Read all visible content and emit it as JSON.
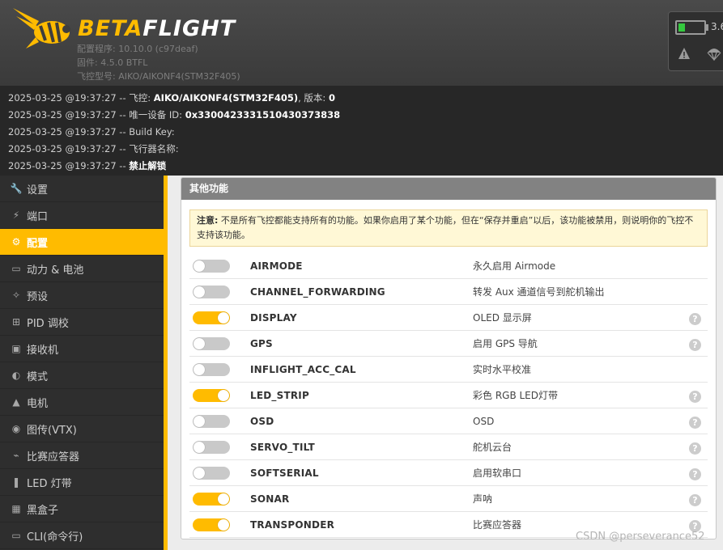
{
  "header": {
    "brand_a": "BETA",
    "brand_b": "FLIGHT",
    "config_version": "配置程序: 10.10.0 (c97deaf)",
    "firmware": "固件: 4.5.0 BTFL",
    "target": "飞控型号: AIKO/AIKONF4(STM32F405)",
    "battery_voltage": "3.6",
    "battery_level": 0.25,
    "accent_color": "#ffbb00"
  },
  "log": [
    {
      "prefix": "2025-03-25 @19:37:27 -- 飞控: ",
      "bold": "AIKO/AIKONF4(STM32F405)",
      "mid": ", 版本: ",
      "bold2": "0"
    },
    {
      "prefix": "2025-03-25 @19:37:27 -- 唯一设备 ID: ",
      "bold": "0x3300423331510430373838",
      "mid": "",
      "bold2": ""
    },
    {
      "prefix": "2025-03-25 @19:37:27 -- Build Key: ",
      "bold": "",
      "mid": "",
      "bold2": ""
    },
    {
      "prefix": "2025-03-25 @19:37:27 -- 飞行器名称: ",
      "bold": "",
      "mid": "",
      "bold2": ""
    },
    {
      "prefix": "2025-03-25 @19:37:27 -- ",
      "bold": "禁止解锁",
      "mid": "",
      "bold2": ""
    }
  ],
  "sidebar": {
    "items": [
      {
        "label": "设置",
        "icon": "wrench-icon"
      },
      {
        "label": "端口",
        "icon": "plug-icon"
      },
      {
        "label": "配置",
        "icon": "gear-icon"
      },
      {
        "label": "动力 & 电池",
        "icon": "battery-icon"
      },
      {
        "label": "预设",
        "icon": "magic-icon"
      },
      {
        "label": "PID 调校",
        "icon": "sitemap-icon"
      },
      {
        "label": "接收机",
        "icon": "receiver-icon"
      },
      {
        "label": "模式",
        "icon": "switch-icon"
      },
      {
        "label": "电机",
        "icon": "motor-icon"
      },
      {
        "label": "图传(VTX)",
        "icon": "broadcast-icon"
      },
      {
        "label": "比赛应答器",
        "icon": "transponder-icon"
      },
      {
        "label": "LED 灯带",
        "icon": "led-icon"
      },
      {
        "label": "黑盒子",
        "icon": "blackbox-icon"
      },
      {
        "label": "CLI(命令行)",
        "icon": "terminal-icon"
      }
    ],
    "active_index": 2
  },
  "panel": {
    "title": "其他功能",
    "note_label": "注意:",
    "note_text": " 不是所有飞控都能支持所有的功能。如果你启用了某个功能，但在“保存并重启”以后，该功能被禁用，则说明你的飞控不支持该功能。",
    "features": [
      {
        "name": "AIRMODE",
        "desc": "永久启用 Airmode",
        "enabled": false,
        "help": false
      },
      {
        "name": "CHANNEL_FORWARDING",
        "desc": "转发 Aux 通道信号到舵机输出",
        "enabled": false,
        "help": false
      },
      {
        "name": "DISPLAY",
        "desc": "OLED 显示屏",
        "enabled": true,
        "help": true
      },
      {
        "name": "GPS",
        "desc": "启用 GPS 导航",
        "enabled": false,
        "help": true
      },
      {
        "name": "INFLIGHT_ACC_CAL",
        "desc": "实时水平校准",
        "enabled": false,
        "help": false
      },
      {
        "name": "LED_STRIP",
        "desc": "彩色 RGB LED灯带",
        "enabled": true,
        "help": true
      },
      {
        "name": "OSD",
        "desc": "OSD",
        "enabled": false,
        "help": true
      },
      {
        "name": "SERVO_TILT",
        "desc": "舵机云台",
        "enabled": false,
        "help": true
      },
      {
        "name": "SOFTSERIAL",
        "desc": "启用软串口",
        "enabled": false,
        "help": true
      },
      {
        "name": "SONAR",
        "desc": "声呐",
        "enabled": true,
        "help": true
      },
      {
        "name": "TRANSPONDER",
        "desc": "比赛应答器",
        "enabled": true,
        "help": true
      }
    ],
    "help_glyph": "?"
  },
  "watermark": "CSDN @perseverance52"
}
